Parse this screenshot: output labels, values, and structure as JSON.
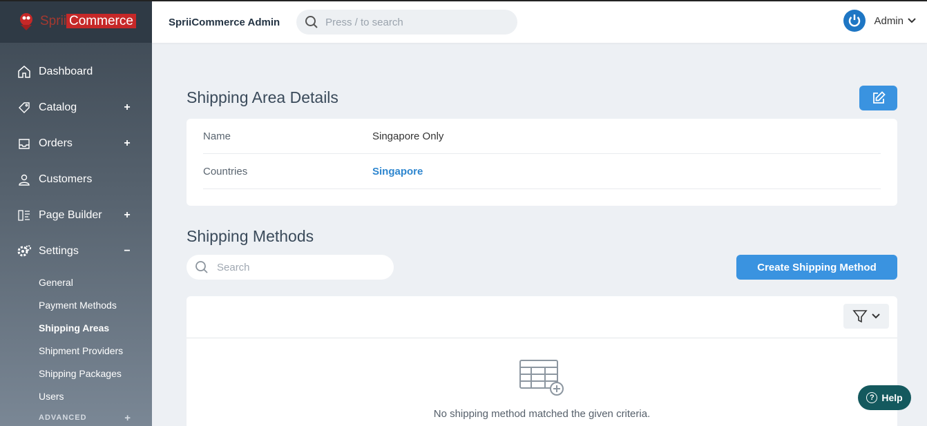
{
  "brand": {
    "logo_part1": "Sprii",
    "logo_part2": "Commerce"
  },
  "header": {
    "title": "SpriiCommerce Admin",
    "search_placeholder": "Press / to search",
    "user_name": "Admin"
  },
  "sidebar": {
    "items": [
      {
        "label": "Dashboard",
        "toggle": ""
      },
      {
        "label": "Catalog",
        "toggle": "+"
      },
      {
        "label": "Orders",
        "toggle": "+"
      },
      {
        "label": "Customers",
        "toggle": ""
      },
      {
        "label": "Page Builder",
        "toggle": "+"
      },
      {
        "label": "Settings",
        "toggle": "−"
      }
    ],
    "settings_sub": [
      "General",
      "Payment Methods",
      "Shipping Areas",
      "Shipment Providers",
      "Shipping Packages",
      "Users"
    ],
    "advanced_label": "ADVANCED",
    "advanced_toggle": "+"
  },
  "page": {
    "title": "Shipping Area Details",
    "details": [
      {
        "key": "Name",
        "value": "Singapore Only"
      },
      {
        "key": "Countries",
        "value": "Singapore"
      }
    ],
    "methods_title": "Shipping Methods",
    "methods_search_placeholder": "Search",
    "create_button": "Create Shipping Method",
    "empty_message": "No shipping method matched the given criteria."
  },
  "help": {
    "label": "Help"
  },
  "colors": {
    "accent": "#3a93e0",
    "help_bg": "#14595e",
    "link": "#2e86cf"
  }
}
